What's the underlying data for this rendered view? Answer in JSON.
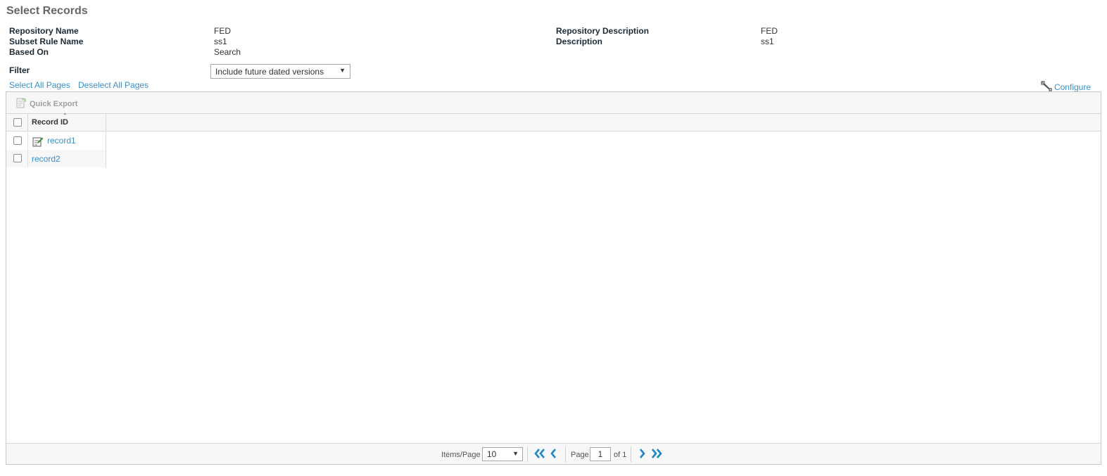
{
  "page": {
    "title": "Select Records"
  },
  "info": {
    "repository_name_label": "Repository Name",
    "repository_name_value": "FED",
    "subset_rule_name_label": "Subset Rule Name",
    "subset_rule_name_value": "ss1",
    "based_on_label": "Based On",
    "based_on_value": "Search",
    "repository_description_label": "Repository Description",
    "repository_description_value": "FED",
    "description_label": "Description",
    "description_value": "ss1"
  },
  "filter": {
    "label": "Filter",
    "selected": "Include future dated versions"
  },
  "actions": {
    "select_all_pages": "Select All Pages",
    "deselect_all_pages": "Deselect All Pages",
    "configure": "Configure"
  },
  "grid": {
    "toolbar": {
      "quick_export": "Quick Export"
    },
    "columns": [
      "Record ID"
    ],
    "rows": [
      {
        "record_id": "record1",
        "has_edit_icon": true
      },
      {
        "record_id": "record2",
        "has_edit_icon": false
      }
    ]
  },
  "pager": {
    "items_per_page_label": "Items/Page",
    "items_per_page": "10",
    "page_label": "Page",
    "current_page": "1",
    "of_label": "of 1"
  },
  "colors": {
    "link": "#3a8fc7",
    "nav_arrows": "#1f86c6",
    "title": "#666666",
    "label": "#1c2b36"
  },
  "icons": {
    "quick_export": "export-document-icon",
    "configure": "wrench-icon",
    "record_edit": "edit-record-icon",
    "first_page": "double-chevron-left-icon",
    "prev_page": "chevron-left-icon",
    "next_page": "chevron-right-icon",
    "last_page": "double-chevron-right-icon"
  }
}
